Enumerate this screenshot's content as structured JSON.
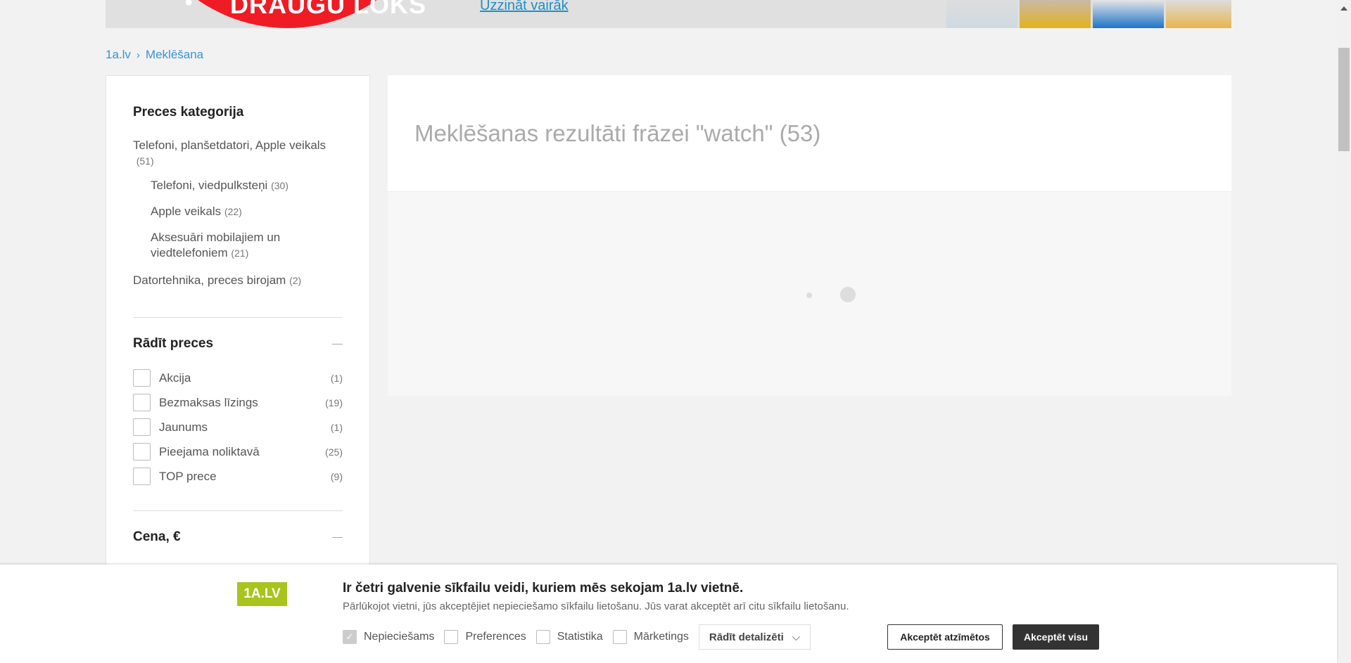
{
  "banner": {
    "title": "DRAUGU LOKS",
    "link": "Uzzināt vairāk"
  },
  "breadcrumb": {
    "home": "1a.lv",
    "current": "Meklēšana"
  },
  "sidebar": {
    "category_title": "Preces kategorija",
    "categories": [
      {
        "label": "Telefoni, planšetdatori, Apple veikals",
        "count": "(51)"
      },
      {
        "label": "Telefoni, viedpulksteņi",
        "count": "(30)"
      },
      {
        "label": "Apple veikals",
        "count": "(22)"
      },
      {
        "label": "Aksesuāri mobilajiem un viedtelefoniem",
        "count": "(21)"
      },
      {
        "label": "Datortehnika, preces birojam",
        "count": "(2)"
      }
    ],
    "show_title": "Rādīt preces",
    "filters": [
      {
        "label": "Akcija",
        "count": "(1)"
      },
      {
        "label": "Bezmaksas līzings",
        "count": "(19)"
      },
      {
        "label": "Jaunums",
        "count": "(1)"
      },
      {
        "label": "Pieejama noliktavā",
        "count": "(25)"
      },
      {
        "label": "TOP prece",
        "count": "(9)"
      }
    ],
    "price_title": "Cena, €"
  },
  "main": {
    "title": "Meklēšanas rezultāti frāzei \"watch\" (53)"
  },
  "cookie": {
    "logo": "1A.LV",
    "heading": "Ir četri galvenie sīkfailu veidi, kuriem mēs sekojam 1a.lv vietnē.",
    "text": "Pārlūkojot vietni, jūs akceptējiet nepieciešamo sīkfailu lietošanu. Jūs varat akceptēt arī citu sīkfailu lietošanu.",
    "options": [
      "Nepieciešams",
      "Preferences",
      "Statistika",
      "Mārketings"
    ],
    "details": "Rādīt detalizēti",
    "accept_selected": "Akceptēt atzīmētos",
    "accept_all": "Akceptēt visu"
  }
}
